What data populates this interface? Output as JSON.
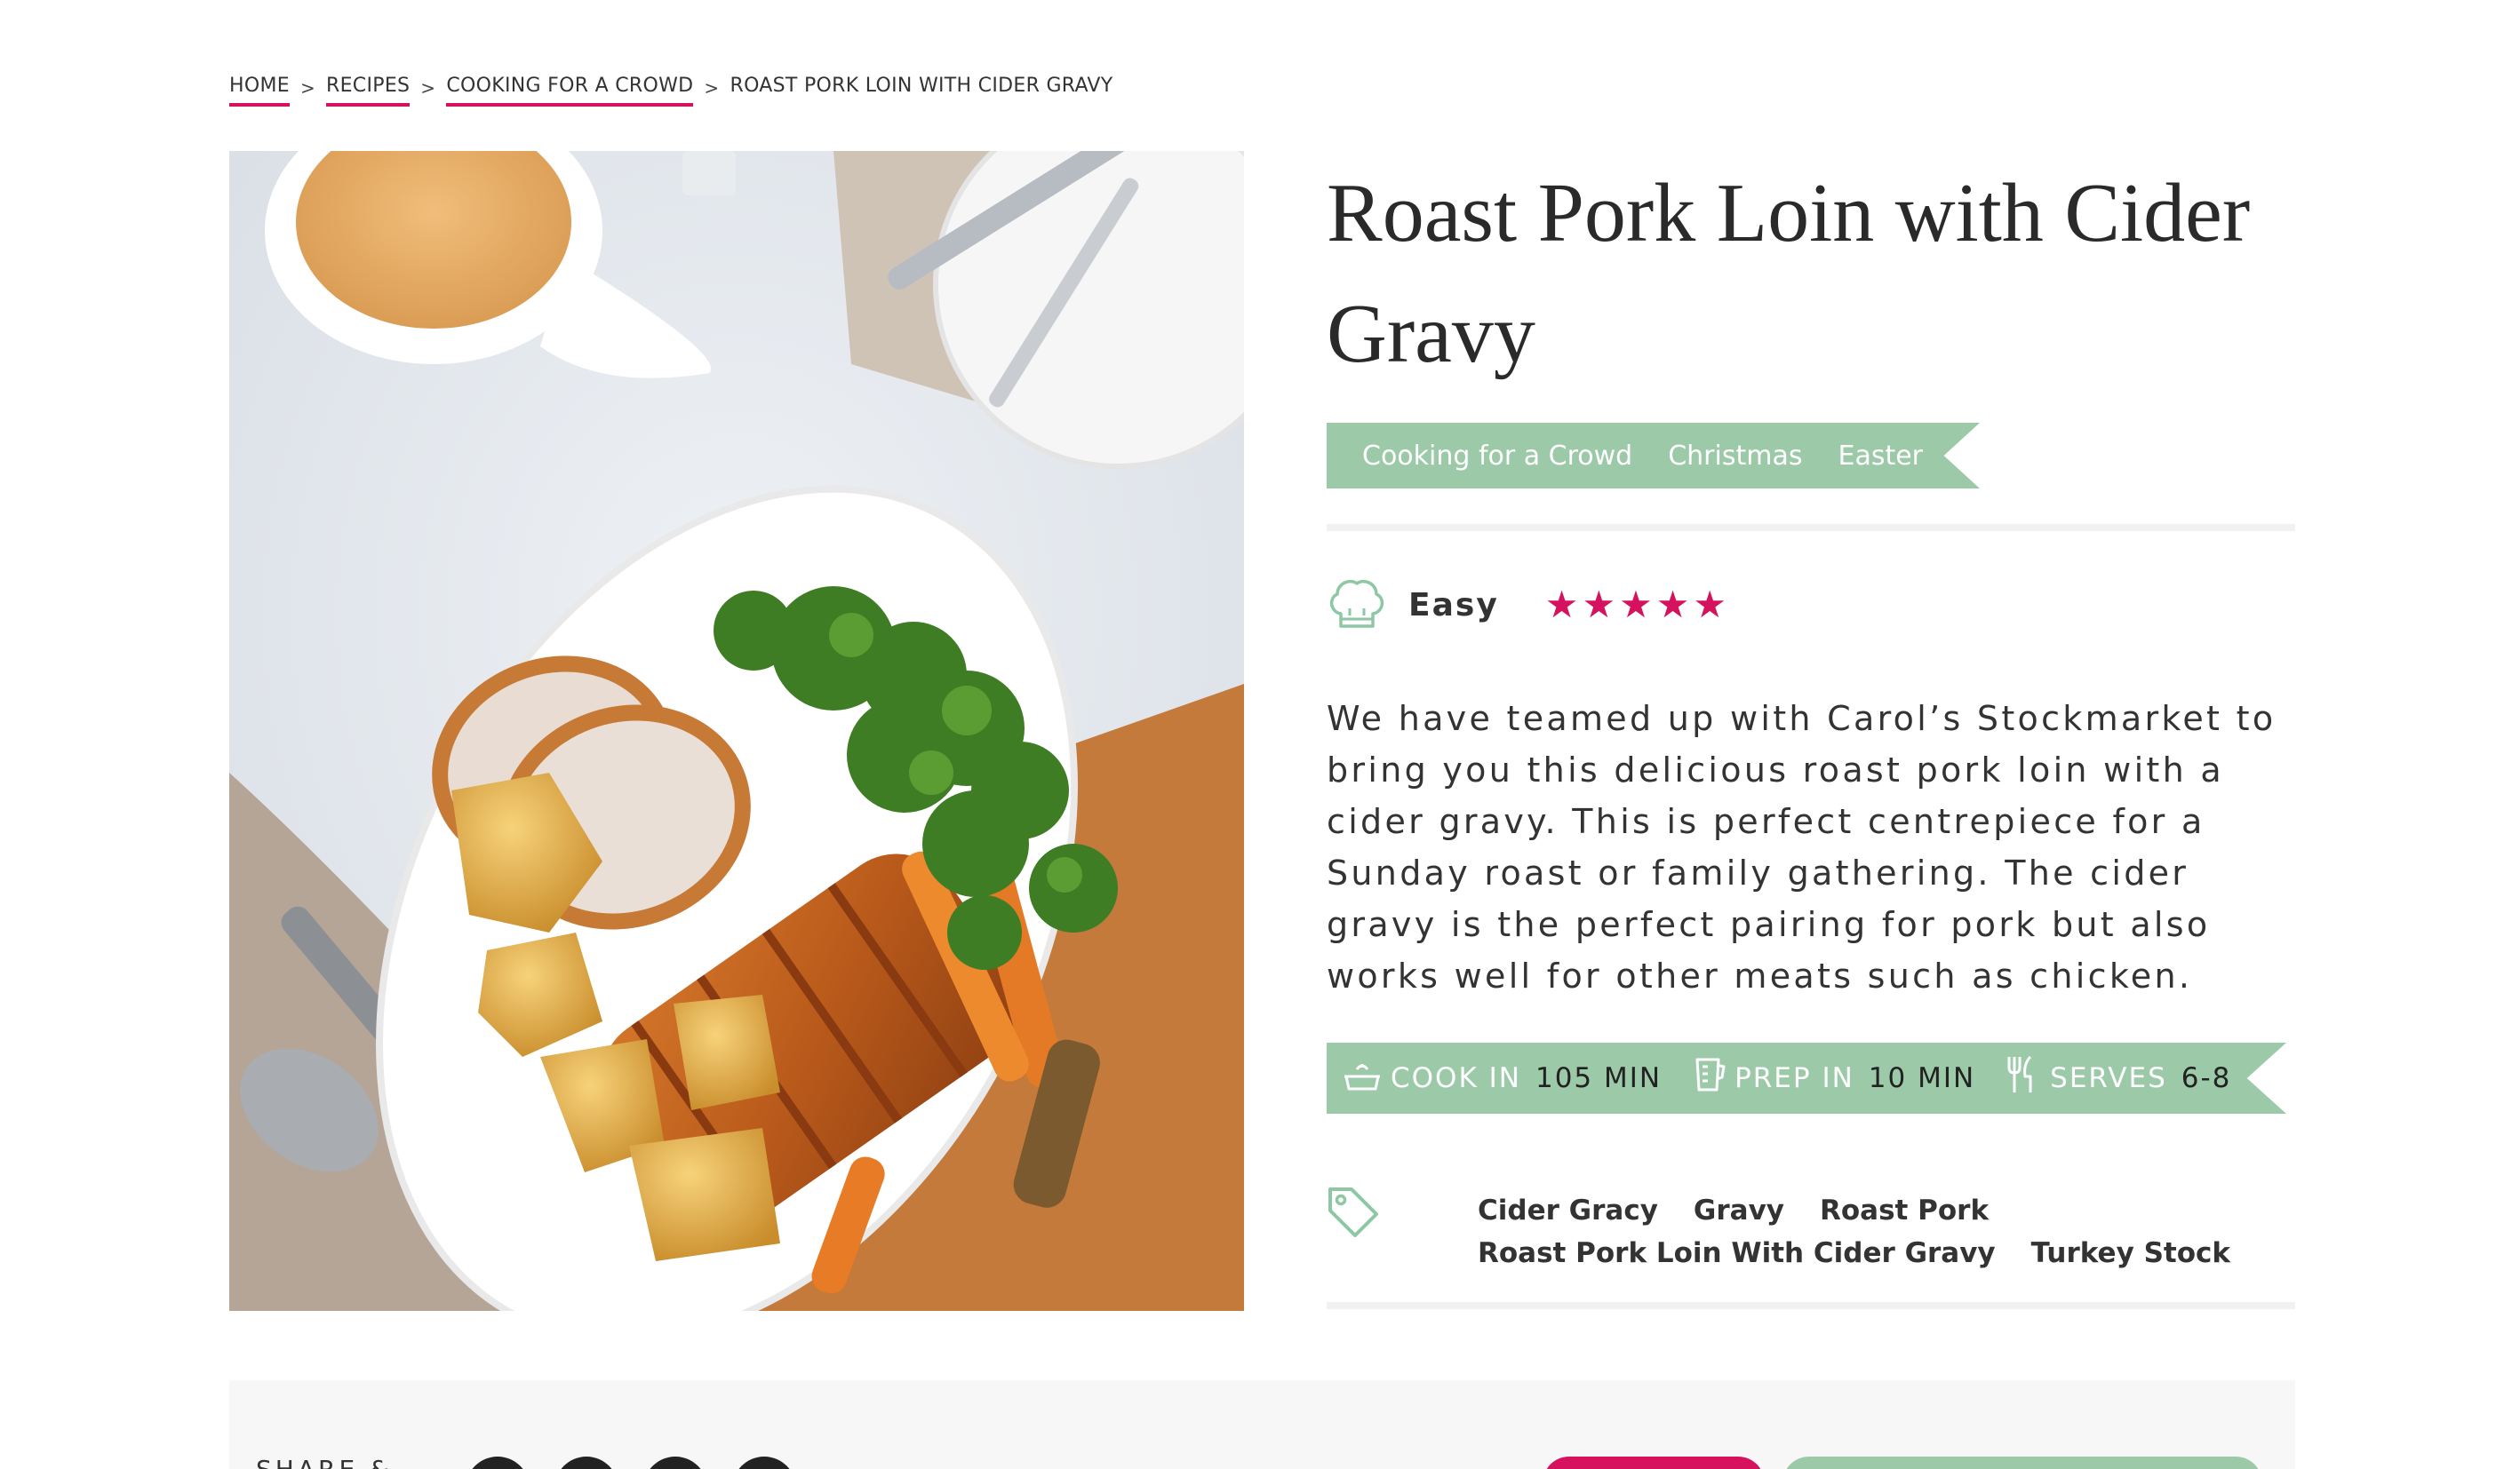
{
  "breadcrumb": {
    "home": "HOME",
    "recipes": "RECIPES",
    "category": "COOKING FOR A CROWD",
    "current": "ROAST PORK LOIN WITH CIDER GRAVY",
    "separator": ">"
  },
  "hero_image": {
    "alt_subject": "roast-pork-loin-platter"
  },
  "recipe": {
    "title": "Roast Pork Loin with Cider Gravy",
    "categories": [
      "Cooking for a Crowd",
      "Christmas",
      "Easter"
    ],
    "difficulty": "Easy",
    "rating": 5,
    "rating_max": 5,
    "description": "We have teamed up with Carol’s Stockmarket to bring you this delicious roast pork loin with a cider gravy. This is perfect centrepiece for a Sunday roast or family gathering. The cider gravy is the perfect pairing for pork but also works well for other meats such as chicken.",
    "info": {
      "cook_label": "COOK IN",
      "cook_value": "105 MIN",
      "prep_label": "PREP IN",
      "prep_value": "10 MIN",
      "serves_label": "SERVES",
      "serves_value": "6-8"
    },
    "tags": [
      "Cider Gracy",
      "Gravy",
      "Roast Pork",
      "Roast Pork Loin With Cider Gravy",
      "Turkey Stock"
    ]
  },
  "share": {
    "label": "SHARE &"
  },
  "colors": {
    "accent": "#d6125f",
    "ribbon": "#9ccaa8",
    "icon_outline": "#8ec7a4",
    "text": "#333333"
  },
  "icons": {
    "difficulty": "chef-hat-icon",
    "cook": "cooking-pot-icon",
    "prep": "measuring-jug-icon",
    "serves": "cutlery-icon",
    "tags": "tag-icon"
  }
}
